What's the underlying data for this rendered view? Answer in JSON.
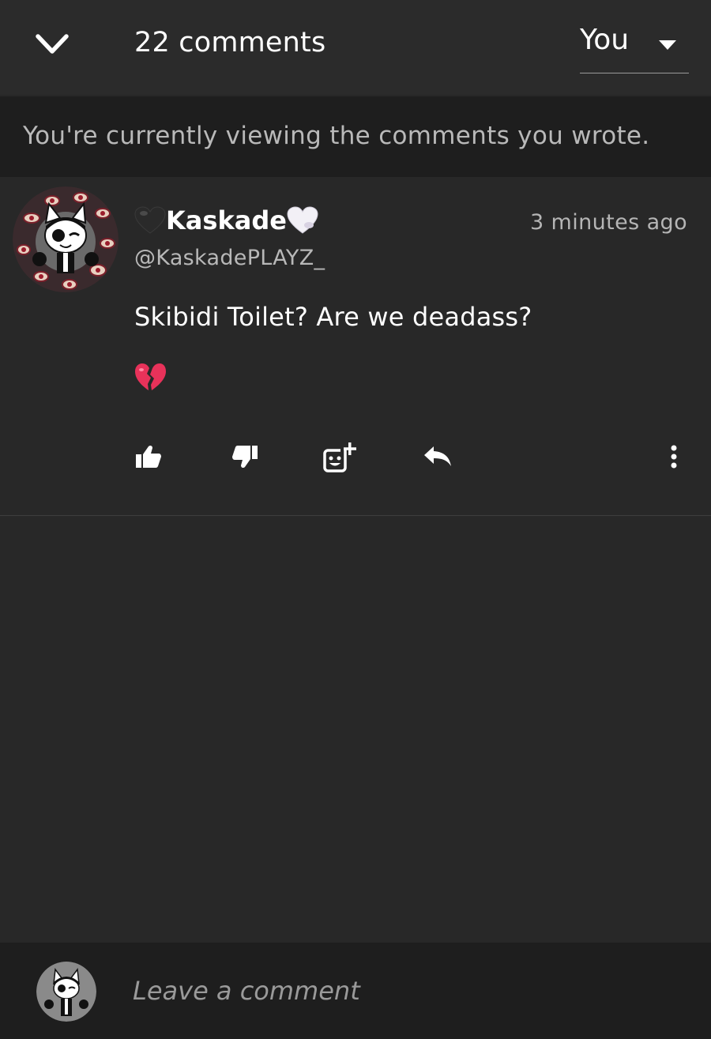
{
  "header": {
    "back_icon": "chevron-down-icon",
    "comment_count": "22 comments",
    "filter": {
      "selected": "You",
      "caret_icon": "caret-down-icon"
    }
  },
  "banner": {
    "text": "You're currently viewing the comments you wrote."
  },
  "comments": [
    {
      "author": "Kaskade",
      "author_prefix_emoji": "black-heart",
      "author_suffix_emoji": "white-heart",
      "handle": "@KaskadePLAYZ_",
      "timestamp": "3 minutes ago",
      "text": "Skibidi Toilet? Are we deadass?",
      "reaction_emoji": "broken-heart",
      "actions": [
        "like-icon",
        "dislike-icon",
        "add-emoji-icon",
        "reply-icon",
        "more-icon"
      ]
    }
  ],
  "composer": {
    "placeholder": "Leave a comment"
  },
  "colors": {
    "background": "#282828",
    "header": "#2b2b2b",
    "banner": "#1e1e1e",
    "text_primary": "#ffffff",
    "text_secondary": "#b8b8b8"
  }
}
